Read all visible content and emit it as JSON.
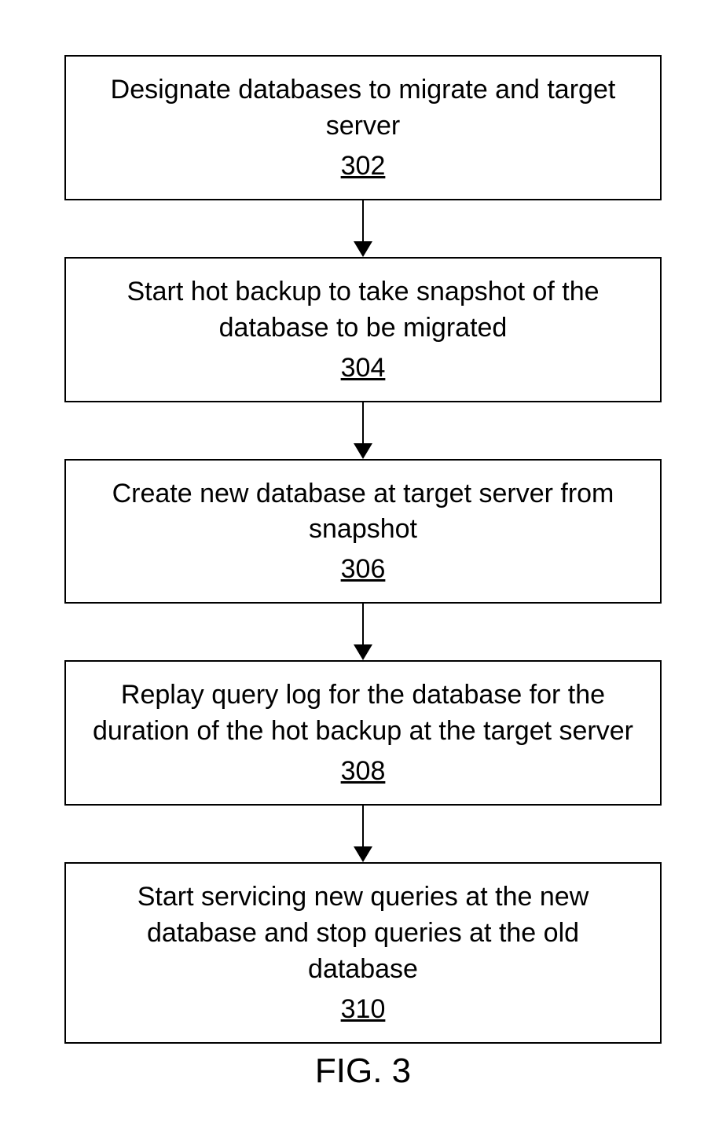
{
  "flowchart": {
    "steps": [
      {
        "text": "Designate databases to migrate and target server",
        "num": "302"
      },
      {
        "text": "Start hot backup to take snapshot of the database to be migrated",
        "num": "304"
      },
      {
        "text": "Create new database at target server from snapshot",
        "num": "306"
      },
      {
        "text": "Replay query log for the database for the duration of the hot backup at the target server",
        "num": "308"
      },
      {
        "text": "Start servicing new queries at the new database and stop queries at the old database",
        "num": "310"
      }
    ]
  },
  "figure_label": "FIG. 3"
}
